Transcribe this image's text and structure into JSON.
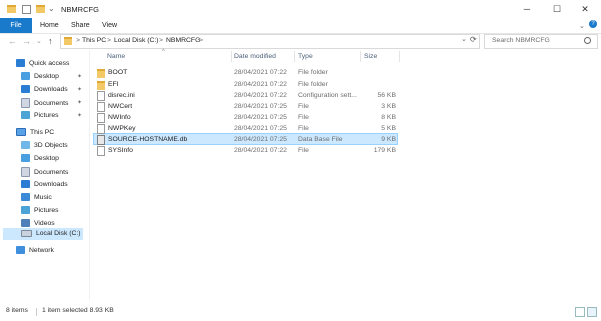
{
  "window": {
    "title": "NBMRCFG",
    "minimize_glyph": "─",
    "maximize_glyph": "☐",
    "close_glyph": "✕"
  },
  "ribbon": {
    "tabs": [
      "File",
      "Home",
      "Share",
      "View"
    ]
  },
  "addressbar": {
    "back_glyph": "←",
    "forward_glyph": "→",
    "dropdown_glyph": "⌄",
    "up_glyph": "↑",
    "sep_glyph": ">",
    "crumbs": [
      "This PC",
      "Local Disk (C:)",
      "NBMRCFG"
    ],
    "refresh_glyph": "⟳"
  },
  "search": {
    "placeholder": "Search NBMRCFG"
  },
  "nav": {
    "quick_access": "Quick access",
    "quick_items": [
      "Desktop",
      "Downloads",
      "Documents",
      "Pictures"
    ],
    "pin_glyph": "📌",
    "this_pc": "This PC",
    "pc_items": [
      "3D Objects",
      "Desktop",
      "Documents",
      "Downloads",
      "Music",
      "Pictures",
      "Videos",
      "Local Disk (C:)"
    ],
    "network": "Network",
    "expand_glyph": "›"
  },
  "columns": {
    "name": "Name",
    "date": "Date modified",
    "type": "Type",
    "size": "Size",
    "sort_glyph": "^"
  },
  "files": [
    {
      "name": "BOOT",
      "date": "28/04/2021 07:22",
      "type": "File folder",
      "size": "",
      "icon": "folder-icon"
    },
    {
      "name": "EFI",
      "date": "28/04/2021 07:22",
      "type": "File folder",
      "size": "",
      "icon": "folder-icon"
    },
    {
      "name": "disrec.ini",
      "date": "28/04/2021 07:22",
      "type": "Configuration sett...",
      "size": "56 KB",
      "icon": "config-file-icon"
    },
    {
      "name": "NWCert",
      "date": "28/04/2021 07:25",
      "type": "File",
      "size": "3 KB",
      "icon": "file-icon"
    },
    {
      "name": "NWInfo",
      "date": "28/04/2021 07:25",
      "type": "File",
      "size": "8 KB",
      "icon": "file-icon"
    },
    {
      "name": "NWPKey",
      "date": "28/04/2021 07:25",
      "type": "File",
      "size": "5 KB",
      "icon": "file-icon"
    },
    {
      "name": "SOURCE-HOSTNAME.db",
      "date": "28/04/2021 07:25",
      "type": "Data Base File",
      "size": "9 KB",
      "icon": "database-file-icon"
    },
    {
      "name": "SYSInfo",
      "date": "28/04/2021 07:22",
      "type": "File",
      "size": "179 KB",
      "icon": "file-icon"
    }
  ],
  "status": {
    "count": "8 items",
    "selection": "1 item selected  8.93 KB"
  },
  "colors": {
    "accent": "#1979ca",
    "selection": "#cce8ff",
    "folder": "#f3c967"
  }
}
